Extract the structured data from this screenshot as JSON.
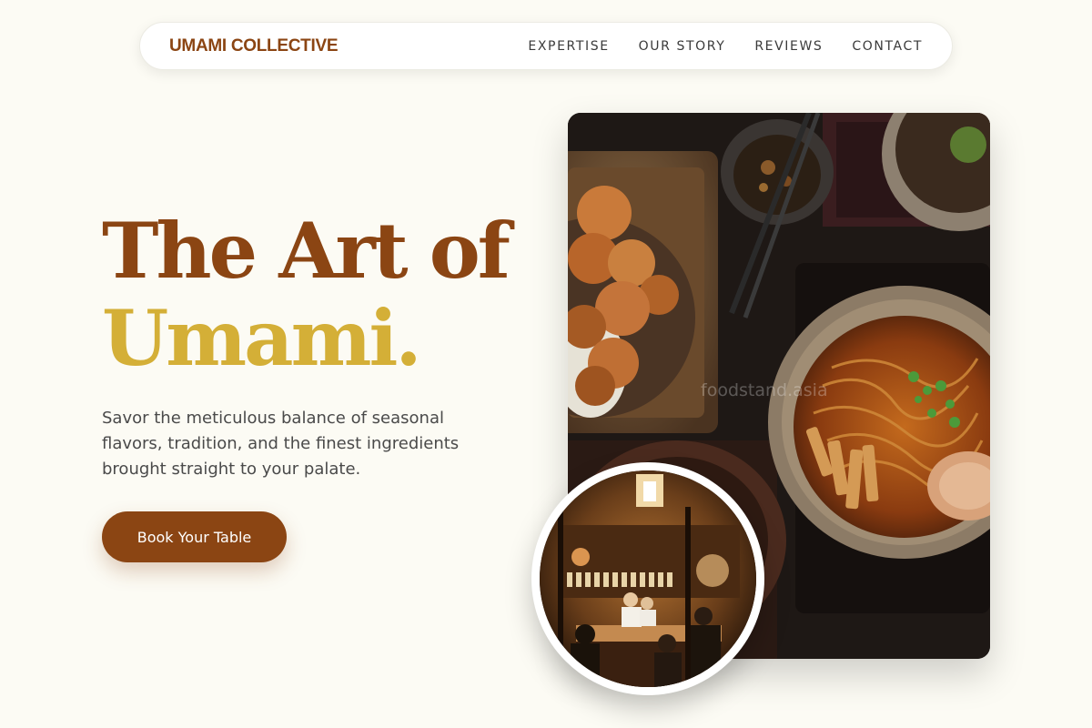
{
  "brand": {
    "name": "UMAMI COLLECTIVE",
    "color": "#8b4513"
  },
  "nav": {
    "links": [
      "EXPERTISE",
      "OUR STORY",
      "REVIEWS",
      "CONTACT"
    ]
  },
  "hero": {
    "title_line1": "The Art of",
    "title_line2": "Umami.",
    "description": "Savor the meticulous balance of seasonal flavors, tradition, and the finest ingredients brought straight to your palate.",
    "cta_label": "Book Your Table"
  },
  "images": {
    "main_watermark": "foodstand.asia",
    "main_icon": "food-photo-icon",
    "inset_icon": "restaurant-interior-photo-icon"
  },
  "colors": {
    "background": "#fcfbf4",
    "primary": "#8b4513",
    "accent": "#d4af37",
    "text": "#4a4a4a"
  }
}
